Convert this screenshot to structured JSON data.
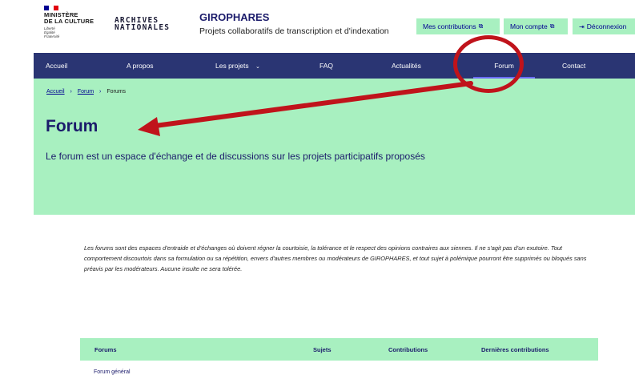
{
  "header": {
    "ministry": [
      "MINISTÈRE",
      "DE LA CULTURE"
    ],
    "motto": [
      "Liberté",
      "Égalité",
      "Fraternité"
    ],
    "archives": [
      "ARCHIVES",
      "NATIONALES"
    ],
    "site_title": "GIROPHARES",
    "site_subtitle": "Projets collaboratifs de transcription et d'indexation",
    "tools": {
      "contributions": "Mes contributions",
      "account": "Mon compte",
      "logout": "Déconnexion"
    }
  },
  "nav": {
    "items": [
      "Accueil",
      "A propos",
      "Les projets",
      "FAQ",
      "Actualités",
      "Forum",
      "Contact"
    ],
    "active": "Forum"
  },
  "breadcrumb": [
    "Accueil",
    "Forum",
    "Forums"
  ],
  "page": {
    "title": "Forum",
    "lead": "Le forum est un espace d'échange et de discussions sur les projets participatifs proposés",
    "notice": "Les forums sont des espaces d'entraide et d'échanges où doivent régner la courtoisie, la tolérance et le respect des opinions contraires aux siennes. Il ne s'agit pas d'un exutoire. Tout comportement discourtois dans sa formulation ou sa répétition, envers d'autres membres ou modérateurs de GIROPHARES, et tout sujet à polémique pourront être supprimés ou bloqués sans préavis par les modérateurs. Aucune insulte ne sera tolérée."
  },
  "table": {
    "headers": [
      "Forums",
      "Sujets",
      "Contributions",
      "Dernières contributions"
    ],
    "rows": [
      "Forum général"
    ]
  },
  "colors": {
    "nav_bg": "#2a3573",
    "hero_bg": "#a8f0c0",
    "title_blue": "#1b1b6b",
    "annotation_red": "#c0131b",
    "flag_blue": "#000091",
    "flag_red": "#e1000f"
  },
  "icons": [
    "external-link-icon",
    "logout-icon",
    "chevron-down-icon",
    "breadcrumb-separator-icon"
  ]
}
